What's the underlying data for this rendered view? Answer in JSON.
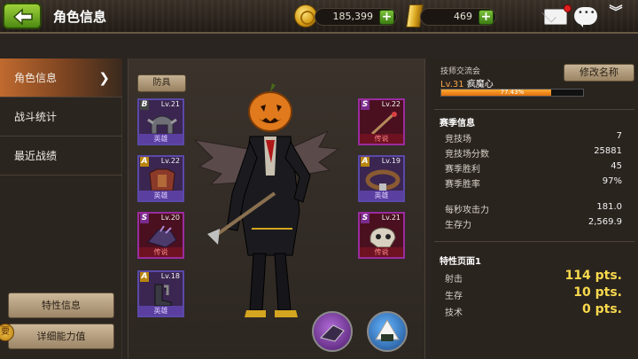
{
  "header": {
    "title": "角色信息",
    "coins": "185,399",
    "gold": "469",
    "plus": "+",
    "collapse_glyph": "︾"
  },
  "sidebar": {
    "items": [
      {
        "label": "角色信息",
        "active": true,
        "chevron": "❯"
      },
      {
        "label": "战斗统计",
        "active": false
      },
      {
        "label": "最近战绩",
        "active": false
      }
    ],
    "trait_button": "特性信息",
    "detail_button": "详细能力值",
    "badge": "要"
  },
  "equipment": {
    "armor_button": "防具",
    "left_slots": [
      {
        "grade": "B",
        "level": "Lv.21",
        "tier": "英雄"
      },
      {
        "grade": "A",
        "level": "Lv.22",
        "tier": "英雄"
      },
      {
        "grade": "S",
        "level": "Lv.20",
        "tier": "传说"
      },
      {
        "grade": "A",
        "level": "Lv.18",
        "tier": "英雄"
      }
    ],
    "right_slots": [
      {
        "grade": "S",
        "level": "Lv.22",
        "tier": "传说"
      },
      {
        "grade": "A",
        "level": "Lv.19",
        "tier": "英雄"
      },
      {
        "grade": "S",
        "level": "Lv.21",
        "tier": "传说"
      }
    ]
  },
  "profile": {
    "guild": "技师交流会",
    "level": "Lv.31",
    "name": "疯魔心",
    "xp_percent": 77.43,
    "xp_text": "77.43%",
    "rename_button": "修改名称"
  },
  "season": {
    "title": "赛季信息",
    "rows": [
      {
        "label": "竞技场",
        "value": "7"
      },
      {
        "label": "竞技场分数",
        "value": "25881"
      },
      {
        "label": "赛季胜利",
        "value": "45"
      },
      {
        "label": "赛季胜率",
        "value": "97%"
      }
    ],
    "rows2": [
      {
        "label": "每秒攻击力",
        "value": "181.0"
      },
      {
        "label": "生存力",
        "value": "2,569.9"
      }
    ]
  },
  "traits": {
    "title": "特性页面1",
    "rows": [
      {
        "label": "射击",
        "value": "114 pts."
      },
      {
        "label": "生存",
        "value": "10 pts."
      },
      {
        "label": "技术",
        "value": "0 pts."
      }
    ]
  },
  "colors": {
    "accent": "#c06a2f",
    "hero": "#5b3fa0",
    "legend": "#6e1221",
    "points": "#f8d94d"
  }
}
